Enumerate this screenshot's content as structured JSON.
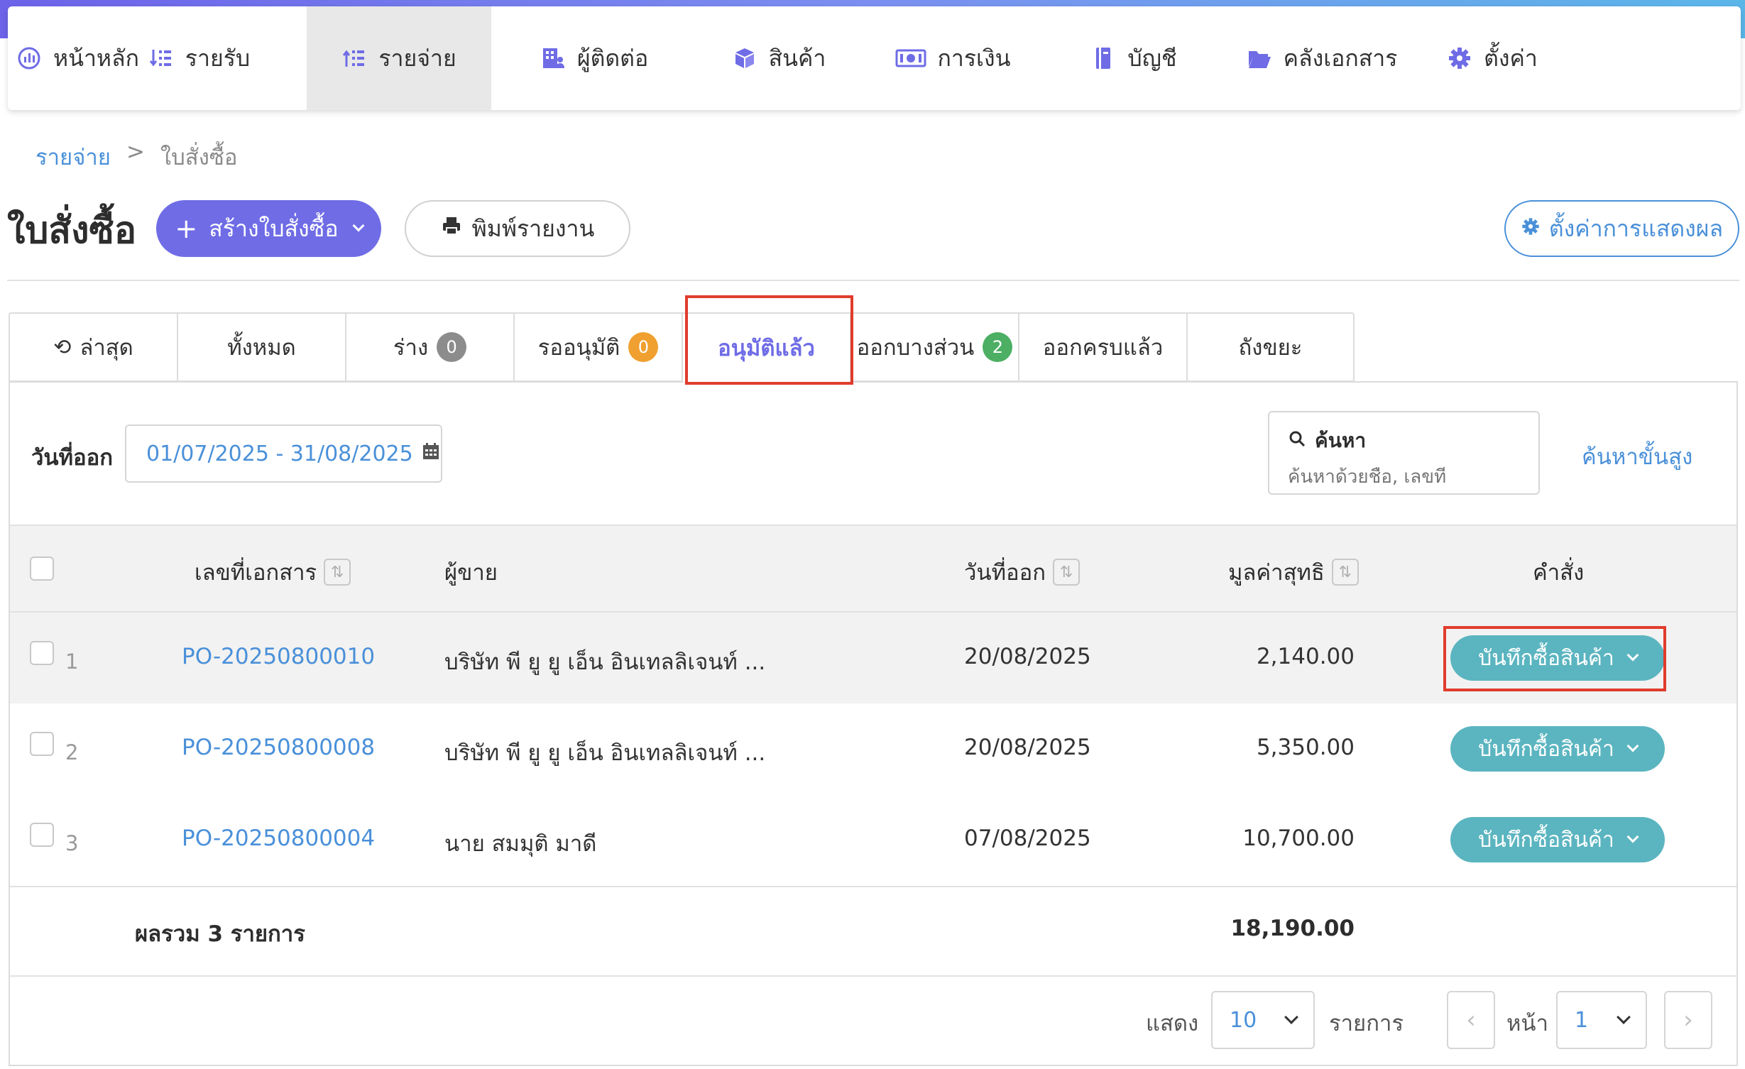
{
  "nav": {
    "items": [
      {
        "label": "หน้าหลัก",
        "icon": "dashboard-icon"
      },
      {
        "label": "รายรับ",
        "icon": "income-list-icon"
      },
      {
        "label": "รายจ่าย",
        "icon": "expense-list-icon",
        "active": true
      },
      {
        "label": "ผู้ติดต่อ",
        "icon": "contacts-building-icon"
      },
      {
        "label": "สินค้า",
        "icon": "product-box-icon"
      },
      {
        "label": "การเงิน",
        "icon": "money-icon"
      },
      {
        "label": "บัญชี",
        "icon": "ledger-book-icon"
      },
      {
        "label": "คลังเอกสาร",
        "icon": "folder-open-icon"
      },
      {
        "label": "ตั้งค่า",
        "icon": "gear-icon"
      }
    ]
  },
  "breadcrumb": {
    "parent": "รายจ่าย",
    "separator": ">",
    "current": "ใบสั่งซื้อ"
  },
  "page": {
    "title": "ใบสั่งซื้อ",
    "create_label": "สร้างใบสั่งซื้อ",
    "print_label": "พิมพ์รายงาน",
    "display_settings_label": "ตั้งค่าการแสดงผล"
  },
  "tabs": [
    {
      "label": "ล่าสุด",
      "icon": "history-icon"
    },
    {
      "label": "ทั้งหมด"
    },
    {
      "label": "ร่าง",
      "badge": "0",
      "badge_color": "#8c8c8c"
    },
    {
      "label": "รออนุมัติ",
      "badge": "0",
      "badge_color": "#f0a030"
    },
    {
      "label": "อนุมัติแล้ว",
      "active": true
    },
    {
      "label": "ออกบางส่วน",
      "badge": "2",
      "badge_color": "#4caf63"
    },
    {
      "label": "ออกครบแล้ว"
    },
    {
      "label": "ถังขยะ"
    }
  ],
  "filters": {
    "date_label": "วันที่ออก",
    "date_range": "01/07/2025 - 31/08/2025",
    "search_label": "ค้นหา",
    "search_placeholder": "ค้นหาด้วยชื่อ, เลขที่",
    "advanced_search": "ค้นหาขั้นสูง"
  },
  "table": {
    "columns": {
      "doc_no": "เลขที่เอกสาร",
      "vendor": "ผู้ขาย",
      "issue_date": "วันที่ออก",
      "net_value": "มูลค่าสุทธิ",
      "action": "คำสั่ง"
    },
    "rows": [
      {
        "index": "1",
        "doc_no": "PO-20250800010",
        "vendor": "บริษัท พี ยู ยู เอ็น อินเทลลิเจนท์ ...",
        "issue_date": "20/08/2025",
        "net_value": "2,140.00",
        "action": "บันทึกซื้อสินค้า"
      },
      {
        "index": "2",
        "doc_no": "PO-20250800008",
        "vendor": "บริษัท พี ยู ยู เอ็น อินเทลลิเจนท์ ...",
        "issue_date": "20/08/2025",
        "net_value": "5,350.00",
        "action": "บันทึกซื้อสินค้า"
      },
      {
        "index": "3",
        "doc_no": "PO-20250800004",
        "vendor": "นาย สมมุติ มาดี",
        "issue_date": "07/08/2025",
        "net_value": "10,700.00",
        "action": "บันทึกซื้อสินค้า"
      }
    ],
    "total_label": "ผลรวม 3 รายการ",
    "total_value": "18,190.00"
  },
  "pagination": {
    "show_label": "แสดง",
    "page_size": "10",
    "items_label": "รายการ",
    "page_label": "หน้า",
    "page": "1"
  },
  "colors": {
    "primary": "#6f6ce6",
    "link": "#4a90d9",
    "action_button": "#5bb5c0",
    "highlight": "#e03c2c"
  }
}
